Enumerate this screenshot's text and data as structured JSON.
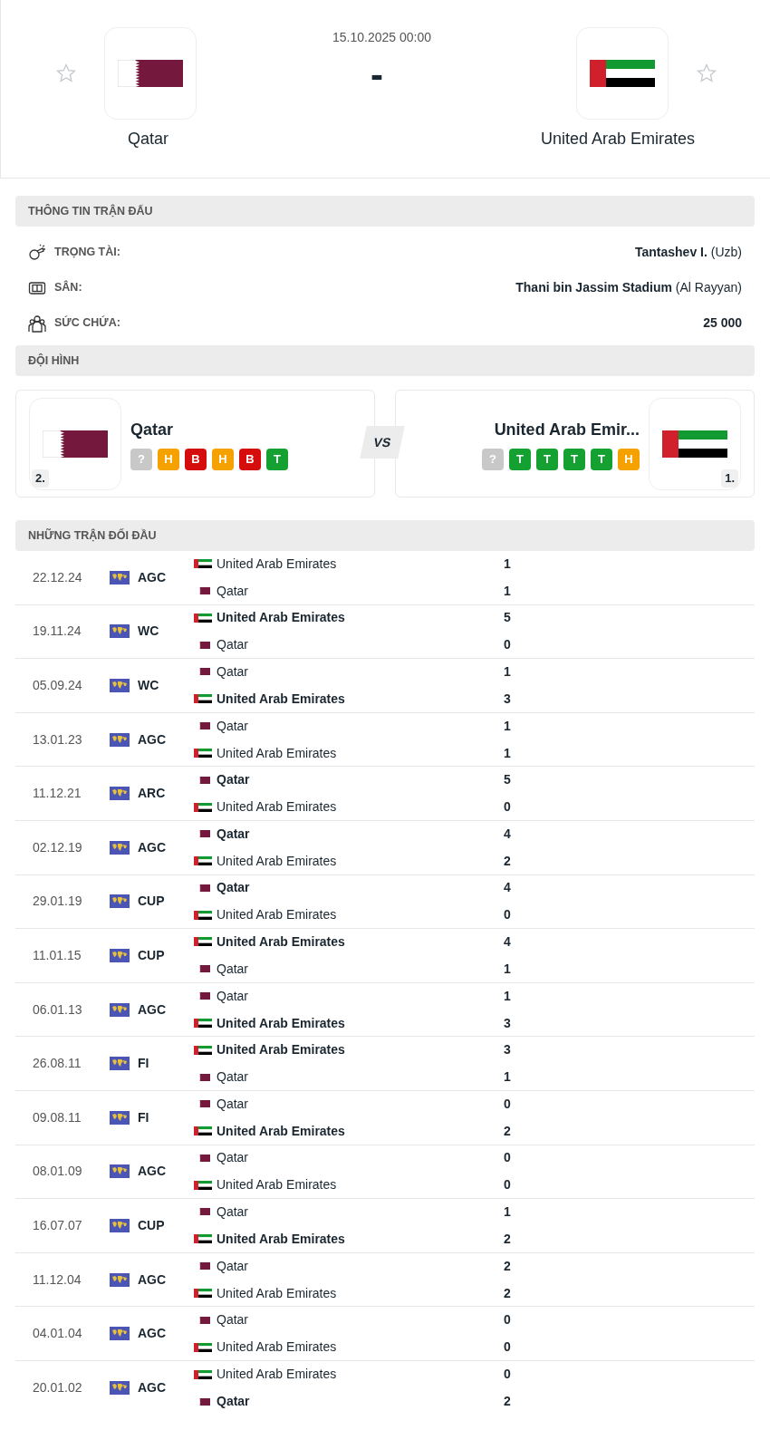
{
  "match": {
    "datetime": "15.10.2025 00:00",
    "score": "-",
    "home": {
      "name": "Qatar",
      "kind": "qatar",
      "favorite": false
    },
    "away": {
      "name": "United Arab Emirates",
      "kind": "uae",
      "favorite": false
    }
  },
  "info": {
    "title": "THÔNG TIN TRẬN ĐẤU",
    "rows": [
      {
        "kind": "referee",
        "label": "TRỌNG TÀI:",
        "value": "Tantashev I.",
        "extra": "(Uzb)"
      },
      {
        "kind": "venue",
        "label": "SÂN:",
        "value": "Thani bin Jassim Stadium",
        "extra": "(Al Rayyan)"
      },
      {
        "kind": "capacity",
        "label": "SỨC CHỨA:",
        "value": "25 000"
      }
    ]
  },
  "lineup": {
    "title": "ĐỘI HÌNH",
    "vs": "VS",
    "teams": [
      {
        "name": "Qatar",
        "kind": "qatar",
        "rank": "2.",
        "form": [
          {
            "label": "?",
            "color": "#c8c8c8"
          },
          {
            "label": "H",
            "color": "#f5a100"
          },
          {
            "label": "B",
            "color": "#d50d0d"
          },
          {
            "label": "H",
            "color": "#f5a100"
          },
          {
            "label": "B",
            "color": "#d50d0d"
          },
          {
            "label": "T",
            "color": "#14a132"
          }
        ]
      },
      {
        "name": "United Arab Emir...",
        "kind": "uae",
        "rank": "1.",
        "form": [
          {
            "label": "?",
            "color": "#c8c8c8"
          },
          {
            "label": "T",
            "color": "#14a132"
          },
          {
            "label": "T",
            "color": "#14a132"
          },
          {
            "label": "T",
            "color": "#14a132"
          },
          {
            "label": "T",
            "color": "#14a132"
          },
          {
            "label": "H",
            "color": "#f5a100"
          }
        ]
      }
    ]
  },
  "h2h": {
    "title": "NHỮNG TRẬN ĐỐI ĐẦU",
    "matches": [
      {
        "date": "22.12.24",
        "competition": "AGC",
        "teams": [
          {
            "name": "United Arab Emirates",
            "kind": "uae",
            "score": "1",
            "winner": false
          },
          {
            "name": "Qatar",
            "kind": "qatar",
            "score": "1",
            "winner": false
          }
        ]
      },
      {
        "date": "19.11.24",
        "competition": "WC",
        "teams": [
          {
            "name": "United Arab Emirates",
            "kind": "uae",
            "score": "5",
            "winner": true
          },
          {
            "name": "Qatar",
            "kind": "qatar",
            "score": "0",
            "winner": false
          }
        ]
      },
      {
        "date": "05.09.24",
        "competition": "WC",
        "teams": [
          {
            "name": "Qatar",
            "kind": "qatar",
            "score": "1",
            "winner": false
          },
          {
            "name": "United Arab Emirates",
            "kind": "uae",
            "score": "3",
            "winner": true
          }
        ]
      },
      {
        "date": "13.01.23",
        "competition": "AGC",
        "teams": [
          {
            "name": "Qatar",
            "kind": "qatar",
            "score": "1",
            "winner": false
          },
          {
            "name": "United Arab Emirates",
            "kind": "uae",
            "score": "1",
            "winner": false
          }
        ]
      },
      {
        "date": "11.12.21",
        "competition": "ARC",
        "teams": [
          {
            "name": "Qatar",
            "kind": "qatar",
            "score": "5",
            "winner": true
          },
          {
            "name": "United Arab Emirates",
            "kind": "uae",
            "score": "0",
            "winner": false
          }
        ]
      },
      {
        "date": "02.12.19",
        "competition": "AGC",
        "teams": [
          {
            "name": "Qatar",
            "kind": "qatar",
            "score": "4",
            "winner": true
          },
          {
            "name": "United Arab Emirates",
            "kind": "uae",
            "score": "2",
            "winner": false
          }
        ]
      },
      {
        "date": "29.01.19",
        "competition": "CUP",
        "teams": [
          {
            "name": "Qatar",
            "kind": "qatar",
            "score": "4",
            "winner": true
          },
          {
            "name": "United Arab Emirates",
            "kind": "uae",
            "score": "0",
            "winner": false
          }
        ]
      },
      {
        "date": "11.01.15",
        "competition": "CUP",
        "teams": [
          {
            "name": "United Arab Emirates",
            "kind": "uae",
            "score": "4",
            "winner": true
          },
          {
            "name": "Qatar",
            "kind": "qatar",
            "score": "1",
            "winner": false
          }
        ]
      },
      {
        "date": "06.01.13",
        "competition": "AGC",
        "teams": [
          {
            "name": "Qatar",
            "kind": "qatar",
            "score": "1",
            "winner": false
          },
          {
            "name": "United Arab Emirates",
            "kind": "uae",
            "score": "3",
            "winner": true
          }
        ]
      },
      {
        "date": "26.08.11",
        "competition": "FI",
        "teams": [
          {
            "name": "United Arab Emirates",
            "kind": "uae",
            "score": "3",
            "winner": true
          },
          {
            "name": "Qatar",
            "kind": "qatar",
            "score": "1",
            "winner": false
          }
        ]
      },
      {
        "date": "09.08.11",
        "competition": "FI",
        "teams": [
          {
            "name": "Qatar",
            "kind": "qatar",
            "score": "0",
            "winner": false
          },
          {
            "name": "United Arab Emirates",
            "kind": "uae",
            "score": "2",
            "winner": true
          }
        ]
      },
      {
        "date": "08.01.09",
        "competition": "AGC",
        "teams": [
          {
            "name": "Qatar",
            "kind": "qatar",
            "score": "0",
            "winner": false
          },
          {
            "name": "United Arab Emirates",
            "kind": "uae",
            "score": "0",
            "winner": false
          }
        ]
      },
      {
        "date": "16.07.07",
        "competition": "CUP",
        "teams": [
          {
            "name": "Qatar",
            "kind": "qatar",
            "score": "1",
            "winner": false
          },
          {
            "name": "United Arab Emirates",
            "kind": "uae",
            "score": "2",
            "winner": true
          }
        ]
      },
      {
        "date": "11.12.04",
        "competition": "AGC",
        "teams": [
          {
            "name": "Qatar",
            "kind": "qatar",
            "score": "2",
            "winner": false
          },
          {
            "name": "United Arab Emirates",
            "kind": "uae",
            "score": "2",
            "winner": false
          }
        ]
      },
      {
        "date": "04.01.04",
        "competition": "AGC",
        "teams": [
          {
            "name": "Qatar",
            "kind": "qatar",
            "score": "0",
            "winner": false
          },
          {
            "name": "United Arab Emirates",
            "kind": "uae",
            "score": "0",
            "winner": false
          }
        ]
      },
      {
        "date": "20.01.02",
        "competition": "AGC",
        "teams": [
          {
            "name": "United Arab Emirates",
            "kind": "uae",
            "score": "0",
            "winner": false
          },
          {
            "name": "Qatar",
            "kind": "qatar",
            "score": "2",
            "winner": true
          }
        ]
      }
    ]
  }
}
